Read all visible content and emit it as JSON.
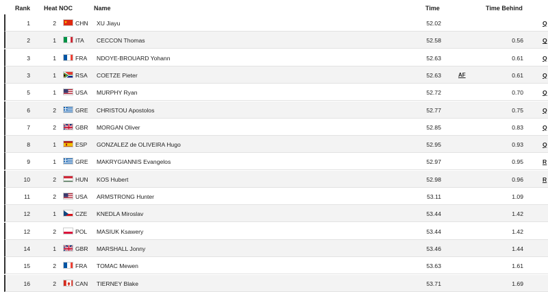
{
  "headers": {
    "rank": "Rank",
    "heat": "Heat",
    "noc": "NOC",
    "name": "Name",
    "time": "Time",
    "behind": "Time Behind"
  },
  "rows": [
    {
      "rank": "1",
      "heat": "2",
      "noc": "CHN",
      "name": "XU Jiayu",
      "time": "52.02",
      "note": "",
      "behind": "",
      "q": "Q"
    },
    {
      "rank": "2",
      "heat": "1",
      "noc": "ITA",
      "name": "CECCON Thomas",
      "time": "52.58",
      "note": "",
      "behind": "0.56",
      "q": "Q"
    },
    {
      "rank": "3",
      "heat": "1",
      "noc": "FRA",
      "name": "NDOYE-BROUARD Yohann",
      "time": "52.63",
      "note": "",
      "behind": "0.61",
      "q": "Q"
    },
    {
      "rank": "3",
      "heat": "1",
      "noc": "RSA",
      "name": "COETZE Pieter",
      "time": "52.63",
      "note": "AF",
      "behind": "0.61",
      "q": "Q"
    },
    {
      "rank": "5",
      "heat": "1",
      "noc": "USA",
      "name": "MURPHY Ryan",
      "time": "52.72",
      "note": "",
      "behind": "0.70",
      "q": "Q"
    },
    {
      "rank": "6",
      "heat": "2",
      "noc": "GRE",
      "name": "CHRISTOU Apostolos",
      "time": "52.77",
      "note": "",
      "behind": "0.75",
      "q": "Q"
    },
    {
      "rank": "7",
      "heat": "2",
      "noc": "GBR",
      "name": "MORGAN Oliver",
      "time": "52.85",
      "note": "",
      "behind": "0.83",
      "q": "Q"
    },
    {
      "rank": "8",
      "heat": "1",
      "noc": "ESP",
      "name": "GONZALEZ de OLIVEIRA Hugo",
      "time": "52.95",
      "note": "",
      "behind": "0.93",
      "q": "Q"
    },
    {
      "rank": "9",
      "heat": "1",
      "noc": "GRE",
      "name": "MAKRYGIANNIS Evangelos",
      "time": "52.97",
      "note": "",
      "behind": "0.95",
      "q": "R"
    },
    {
      "rank": "10",
      "heat": "2",
      "noc": "HUN",
      "name": "KOS Hubert",
      "time": "52.98",
      "note": "",
      "behind": "0.96",
      "q": "R"
    },
    {
      "rank": "11",
      "heat": "2",
      "noc": "USA",
      "name": "ARMSTRONG Hunter",
      "time": "53.11",
      "note": "",
      "behind": "1.09",
      "q": ""
    },
    {
      "rank": "12",
      "heat": "1",
      "noc": "CZE",
      "name": "KNEDLA Miroslav",
      "time": "53.44",
      "note": "",
      "behind": "1.42",
      "q": ""
    },
    {
      "rank": "12",
      "heat": "2",
      "noc": "POL",
      "name": "MASIUK Ksawery",
      "time": "53.44",
      "note": "",
      "behind": "1.42",
      "q": ""
    },
    {
      "rank": "14",
      "heat": "1",
      "noc": "GBR",
      "name": "MARSHALL Jonny",
      "time": "53.46",
      "note": "",
      "behind": "1.44",
      "q": ""
    },
    {
      "rank": "15",
      "heat": "2",
      "noc": "FRA",
      "name": "TOMAC Mewen",
      "time": "53.63",
      "note": "",
      "behind": "1.61",
      "q": ""
    },
    {
      "rank": "16",
      "heat": "2",
      "noc": "CAN",
      "name": "TIERNEY Blake",
      "time": "53.71",
      "note": "",
      "behind": "1.69",
      "q": ""
    }
  ],
  "flag_icons": {
    "CHN": "china-flag-icon",
    "ITA": "italy-flag-icon",
    "FRA": "france-flag-icon",
    "RSA": "south-africa-flag-icon",
    "USA": "usa-flag-icon",
    "GRE": "greece-flag-icon",
    "GBR": "uk-flag-icon",
    "ESP": "spain-flag-icon",
    "HUN": "hungary-flag-icon",
    "CZE": "czech-flag-icon",
    "POL": "poland-flag-icon",
    "CAN": "canada-flag-icon"
  },
  "colors": {
    "row_alt": "#f3f3f3",
    "row_border": "#303030"
  }
}
